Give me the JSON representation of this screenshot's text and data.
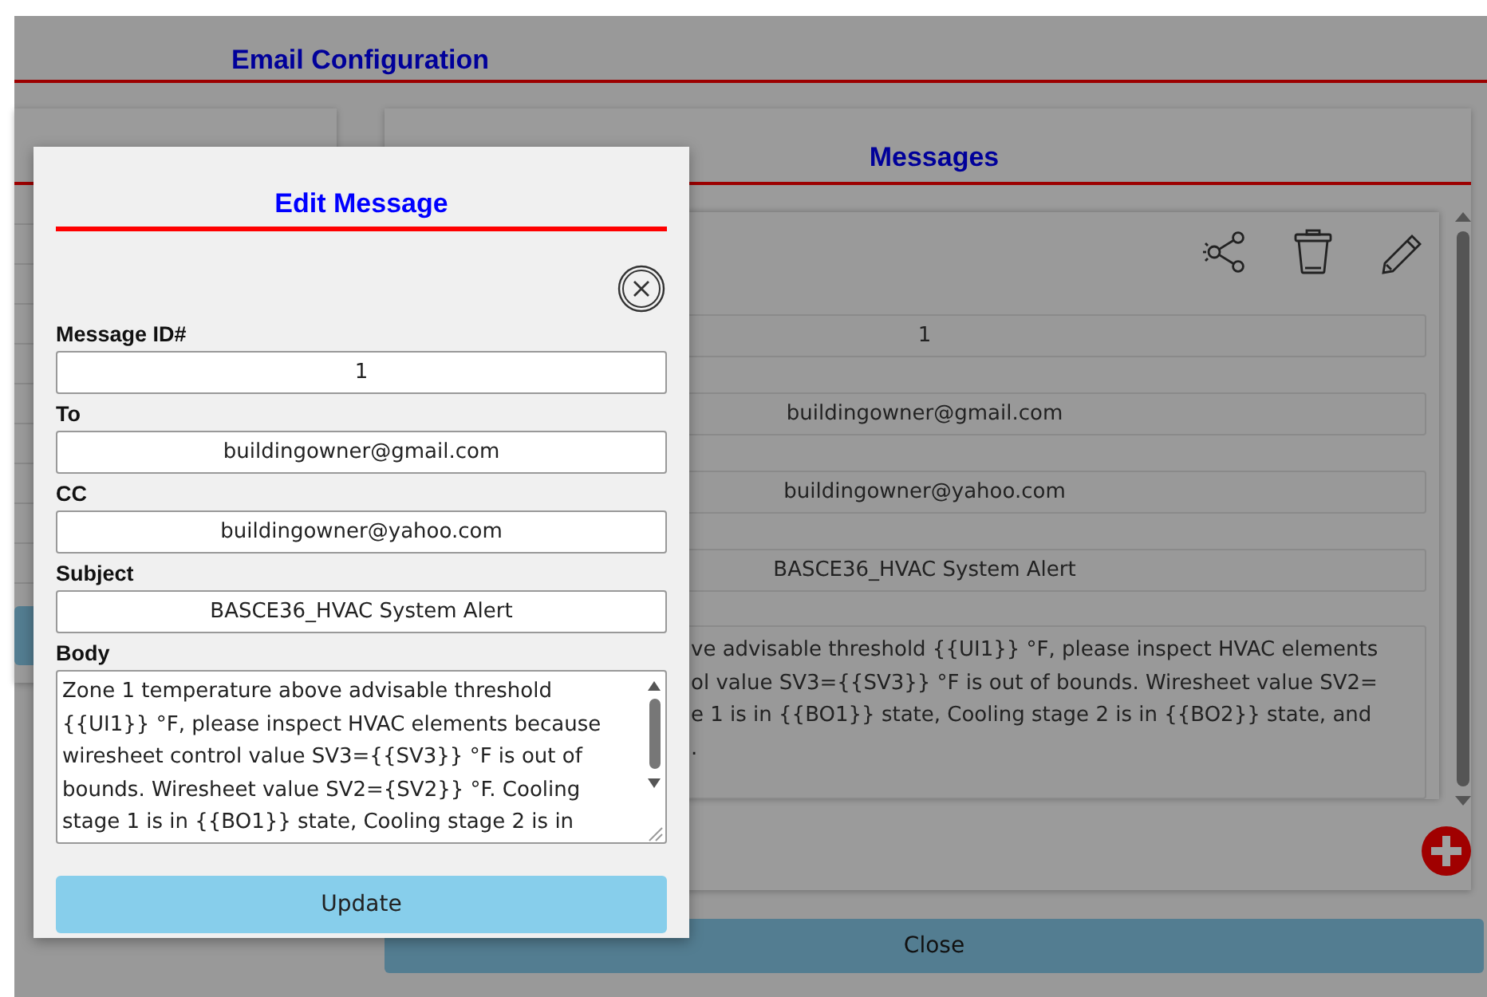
{
  "page": {
    "title": "Email Configuration"
  },
  "messages_panel": {
    "title": "Messages",
    "fields": [
      {
        "value": "1"
      },
      {
        "value": "buildingowner@gmail.com"
      },
      {
        "value": "buildingowner@yahoo.com"
      },
      {
        "value": "BASCE36_HVAC System Alert"
      }
    ],
    "body_lines": [
      "ve advisable threshold {{UI1}} °F, please inspect HVAC elements",
      "ol value SV3={{SV3}} °F is out of bounds. Wiresheet value SV2=",
      "e 1 is in {{BO1}} state, Cooling stage 2 is in {{BO2}} state, and",
      "."
    ]
  },
  "close_button": "Close",
  "edit_dialog": {
    "title": "Edit Message",
    "fields": [
      {
        "label": "Message ID#",
        "value": "1",
        "kind": "input"
      },
      {
        "label": "To",
        "value": "buildingowner@gmail.com",
        "kind": "input"
      },
      {
        "label": "CC",
        "value": "buildingowner@yahoo.com",
        "kind": "input"
      },
      {
        "label": "Subject",
        "value": "BASCE36_HVAC System Alert",
        "kind": "input"
      },
      {
        "label": "Body",
        "value": "Zone 1 temperature above advisable threshold {{UI1}} °F, please inspect HVAC elements because wiresheet control value SV3={{SV3}} °F is out of bounds. Wiresheet value SV2={SV2}} °F. Cooling stage 1 is in {{BO1}} state, Cooling stage 2 is in",
        "kind": "textarea"
      }
    ],
    "button": "Update"
  }
}
